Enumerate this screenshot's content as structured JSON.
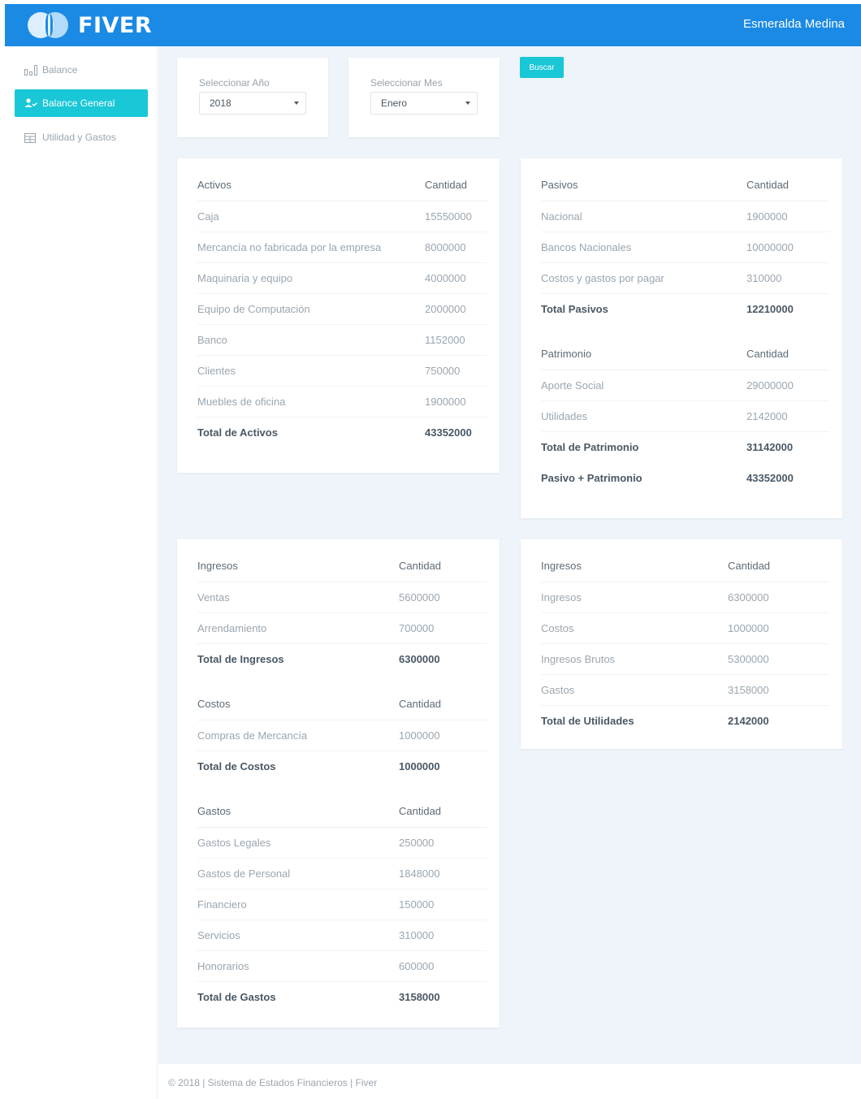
{
  "header": {
    "brand": "FIVER",
    "user_name": "Esmeralda Medina"
  },
  "sidebar": {
    "items": [
      {
        "label": "Balance",
        "icon": "bar-chart-icon"
      },
      {
        "label": "Balance General",
        "icon": "user-check-icon"
      },
      {
        "label": "Utilidad y Gastos",
        "icon": "table-icon"
      }
    ]
  },
  "filters": {
    "year_label": "Seleccionar Año",
    "year_value": "2018",
    "month_label": "Seleccionar Mes",
    "month_value": "Enero",
    "search_label": "Buscar"
  },
  "activos": {
    "header": [
      "Activos",
      "Cantidad"
    ],
    "rows": [
      [
        "Caja",
        "15550000"
      ],
      [
        "Mercancía no fabricada por la empresa",
        "8000000"
      ],
      [
        "Maquinaria y equipo",
        "4000000"
      ],
      [
        "Equipo de Computación",
        "2000000"
      ],
      [
        "Banco",
        "1152000"
      ],
      [
        "Clientes",
        "750000"
      ],
      [
        "Muebles de oficina",
        "1900000"
      ]
    ],
    "total": [
      "Total de Activos",
      "43352000"
    ]
  },
  "pasivos": {
    "header": [
      "Pasivos",
      "Cantidad"
    ],
    "rows": [
      [
        "Nacional",
        "1900000"
      ],
      [
        "Bancos Nacionales",
        "10000000"
      ],
      [
        "Costos y gastos por pagar",
        "310000"
      ]
    ],
    "total": [
      "Total Pasivos",
      "12210000"
    ]
  },
  "patrimonio": {
    "header": [
      "Patrimonio",
      "Cantidad"
    ],
    "rows": [
      [
        "Aporte Social",
        "29000000"
      ],
      [
        "Utilidades",
        "2142000"
      ]
    ],
    "total": [
      "Total de Patrimonio",
      "31142000"
    ],
    "grand_total": [
      "Pasivo + Patrimonio",
      "43352000"
    ]
  },
  "ingresos": {
    "header": [
      "Ingresos",
      "Cantidad"
    ],
    "rows": [
      [
        "Ventas",
        "5600000"
      ],
      [
        "Arrendamiento",
        "700000"
      ]
    ],
    "total": [
      "Total de Ingresos",
      "6300000"
    ]
  },
  "costos": {
    "header": [
      "Costos",
      "Cantidad"
    ],
    "rows": [
      [
        "Compras de Mercancía",
        "1000000"
      ]
    ],
    "total": [
      "Total de Costos",
      "1000000"
    ]
  },
  "gastos": {
    "header": [
      "Gastos",
      "Cantidad"
    ],
    "rows": [
      [
        "Gastos Legales",
        "250000"
      ],
      [
        "Gastos de Personal",
        "1848000"
      ],
      [
        "Financiero",
        "150000"
      ],
      [
        "Servicios",
        "310000"
      ],
      [
        "Honorarios",
        "600000"
      ]
    ],
    "total": [
      "Total de Gastos",
      "3158000"
    ]
  },
  "utilidades": {
    "header": [
      "Ingresos",
      "Cantidad"
    ],
    "rows": [
      [
        "Ingresos",
        "6300000"
      ],
      [
        "Costos",
        "1000000"
      ],
      [
        "Ingresos Brutos",
        "5300000"
      ],
      [
        "Gastos",
        "3158000"
      ]
    ],
    "total": [
      "Total de Utilidades",
      "2142000"
    ]
  },
  "footer": {
    "text": "© 2018 | Sistema de Estados Financieros | Fiver"
  },
  "colors": {
    "primary": "#1a8ae5",
    "accent": "#19c7d6",
    "background": "#eef4f9"
  }
}
